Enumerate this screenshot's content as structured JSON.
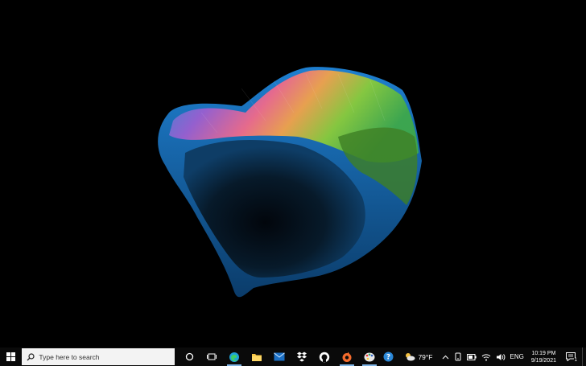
{
  "desktop": {
    "wallpaper": "abstract-colorful-3d-shape"
  },
  "taskbar": {
    "start_icon": "windows-logo-icon",
    "search": {
      "placeholder": "Type here to search",
      "icon": "search-icon"
    },
    "pinned": [
      {
        "name": "cortana-icon"
      },
      {
        "name": "task-view-icon"
      },
      {
        "name": "edge-icon",
        "running": true
      },
      {
        "name": "file-explorer-icon"
      },
      {
        "name": "mail-icon"
      },
      {
        "name": "dropbox-icon"
      },
      {
        "name": "github-desktop-icon"
      },
      {
        "name": "origin-icon",
        "running": true
      },
      {
        "name": "paint-icon",
        "running": true
      }
    ]
  },
  "tray": {
    "help_icon": "help-icon",
    "weather": {
      "icon": "partly-sunny-icon",
      "temperature": "79°F"
    },
    "language": "ENG",
    "clock": {
      "time": "10:19 PM",
      "date": "9/19/2021"
    },
    "notification_count": "1"
  },
  "colors": {
    "taskbar_bg": "#0a0a0a",
    "accent": "#7fb4e6",
    "search_bg": "#f3f3f3"
  }
}
